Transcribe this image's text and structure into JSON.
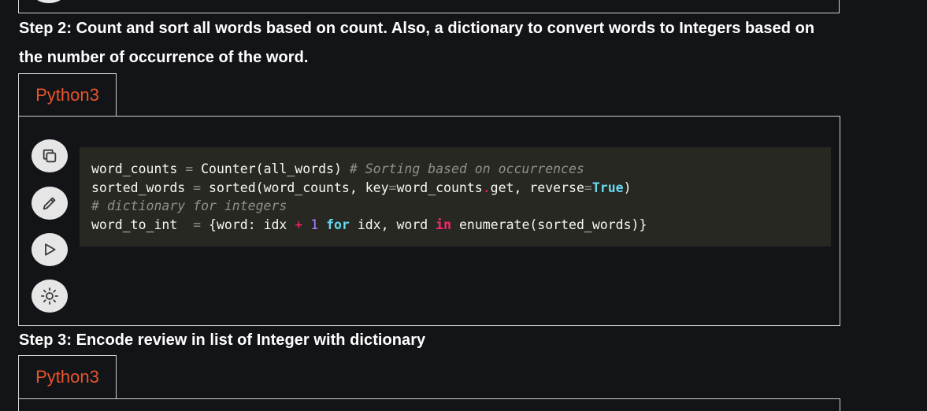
{
  "step2": {
    "text": "Step 2: Count and sort all words based on count. Also, a dictionary to convert words to Integers based on the number of occurrence of the word."
  },
  "step3": {
    "text": "Step 3: Encode review in list of Integer with dictionary"
  },
  "tabs": [
    {
      "label": "Python3"
    },
    {
      "label": "Python3"
    }
  ],
  "toolbar": {
    "icons": [
      "copy-icon",
      "edit-icon",
      "run-icon",
      "theme-icon"
    ]
  },
  "code": {
    "line1": {
      "var": "word_counts",
      "eq": "=",
      "call": "Counter(all_words)",
      "comment": "# Sorting based on occurrences"
    },
    "line2": {
      "var": "sorted_words",
      "eq": "=",
      "call1": "sorted(word_counts, key",
      "eq2": "=",
      "call2": "word_counts",
      "dot": ".",
      "call3": "get, reverse",
      "eq3": "=",
      "true": "True",
      "close": ")"
    },
    "line3": {
      "comment": "# dictionary for integers"
    },
    "line4": {
      "var": "word_to_int",
      "eq": "=",
      "p1": "{word: idx",
      "plus": "+",
      "num": "1",
      "kw_for": "for",
      "p2": "idx, word",
      "kw_in": "in",
      "p3": "enumerate(sorted_words)}"
    }
  },
  "colors": {
    "background": "#131417",
    "code_background": "#272822",
    "tab_text": "#e8542c",
    "border": "#d0d0d0"
  }
}
